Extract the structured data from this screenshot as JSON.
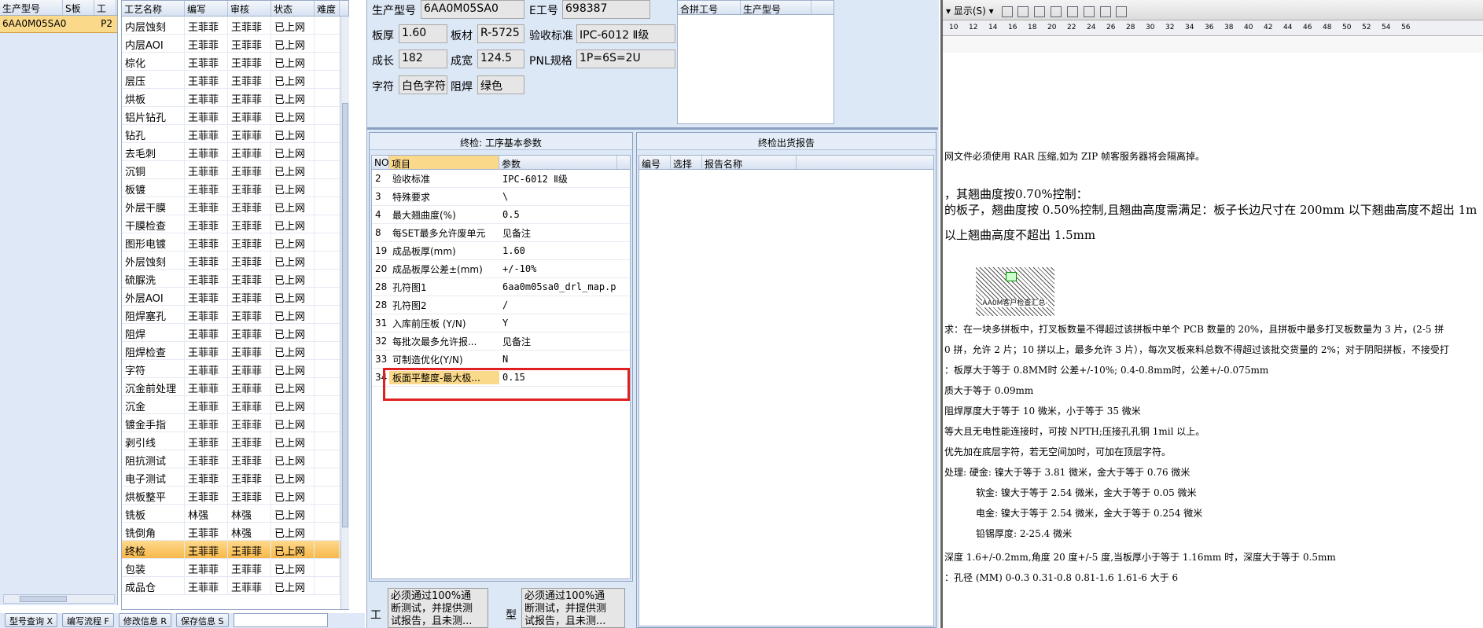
{
  "left_grid": {
    "headers": [
      "生产型号",
      "S板",
      "工"
    ],
    "selected_row": {
      "model": "6AA0M05SA0",
      "s": "P2"
    }
  },
  "process_grid": {
    "headers": [
      "工艺名称",
      "编写",
      "审核",
      "状态",
      "难度"
    ],
    "rows": [
      [
        "内层蚀刻",
        "王菲菲",
        "王菲菲",
        "已上网"
      ],
      [
        "内层AOI",
        "王菲菲",
        "王菲菲",
        "已上网"
      ],
      [
        "棕化",
        "王菲菲",
        "王菲菲",
        "已上网"
      ],
      [
        "层压",
        "王菲菲",
        "王菲菲",
        "已上网"
      ],
      [
        "烘板",
        "王菲菲",
        "王菲菲",
        "已上网"
      ],
      [
        "铝片钻孔",
        "王菲菲",
        "王菲菲",
        "已上网"
      ],
      [
        "钻孔",
        "王菲菲",
        "王菲菲",
        "已上网"
      ],
      [
        "去毛刺",
        "王菲菲",
        "王菲菲",
        "已上网"
      ],
      [
        "沉铜",
        "王菲菲",
        "王菲菲",
        "已上网"
      ],
      [
        "板镀",
        "王菲菲",
        "王菲菲",
        "已上网"
      ],
      [
        "外层干膜",
        "王菲菲",
        "王菲菲",
        "已上网"
      ],
      [
        "干膜检查",
        "王菲菲",
        "王菲菲",
        "已上网"
      ],
      [
        "图形电镀",
        "王菲菲",
        "王菲菲",
        "已上网"
      ],
      [
        "外层蚀刻",
        "王菲菲",
        "王菲菲",
        "已上网"
      ],
      [
        "硫脲洗",
        "王菲菲",
        "王菲菲",
        "已上网"
      ],
      [
        "外层AOI",
        "王菲菲",
        "王菲菲",
        "已上网"
      ],
      [
        "阻焊塞孔",
        "王菲菲",
        "王菲菲",
        "已上网"
      ],
      [
        "阻焊",
        "王菲菲",
        "王菲菲",
        "已上网"
      ],
      [
        "阻焊检查",
        "王菲菲",
        "王菲菲",
        "已上网"
      ],
      [
        "字符",
        "王菲菲",
        "王菲菲",
        "已上网"
      ],
      [
        "沉金前处理",
        "王菲菲",
        "王菲菲",
        "已上网"
      ],
      [
        "沉金",
        "王菲菲",
        "王菲菲",
        "已上网"
      ],
      [
        "镀金手指",
        "王菲菲",
        "王菲菲",
        "已上网"
      ],
      [
        "剥引线",
        "王菲菲",
        "王菲菲",
        "已上网"
      ],
      [
        "阻抗测试",
        "王菲菲",
        "王菲菲",
        "已上网"
      ],
      [
        "电子测试",
        "王菲菲",
        "王菲菲",
        "已上网"
      ],
      [
        "烘板整平",
        "王菲菲",
        "王菲菲",
        "已上网"
      ],
      [
        "铣板",
        "林强",
        "林强",
        "已上网"
      ],
      [
        "铣倒角",
        "王菲菲",
        "林强",
        "已上网"
      ],
      [
        "终检",
        "王菲菲",
        "王菲菲",
        "已上网"
      ],
      [
        "包装",
        "王菲菲",
        "王菲菲",
        "已上网"
      ],
      [
        "成品仓",
        "王菲菲",
        "王菲菲",
        "已上网"
      ]
    ],
    "active_index": 29
  },
  "bottom_buttons": [
    "型号查询 X",
    "编写流程 F",
    "修改信息 R",
    "保存信息 S"
  ],
  "info": {
    "model_label": "生产型号",
    "model_value": "6AA0M05SA0",
    "e_label": "E工号",
    "e_value": "698387",
    "thick_label": "板厚",
    "thick_value": "1.60",
    "mat_label": "板材",
    "mat_value": "R-5725",
    "std_label": "验收标准",
    "std_value": "IPC-6012 Ⅱ级",
    "len_label": "成长",
    "len_value": "182",
    "wid_label": "成宽",
    "wid_value": "124.5",
    "pnl_label": "PNL规格",
    "pnl_value": "1P=6S=2U",
    "char_label": "字符",
    "char_value": "白色字符",
    "mask_label": "阻焊",
    "mask_value": "绿色",
    "merge_headers": [
      "合拼工号",
      "生产型号"
    ]
  },
  "params_panel": {
    "title": "终检: 工序基本参数",
    "headers": [
      "NO",
      "项目",
      "参数"
    ],
    "rows": [
      [
        "2",
        "验收标准",
        "IPC-6012 Ⅱ级"
      ],
      [
        "3",
        "特殊要求",
        "\\"
      ],
      [
        "4",
        "最大翘曲度(%)",
        "0.5"
      ],
      [
        "8",
        "每SET最多允许废单元",
        "见备注"
      ],
      [
        "19",
        "成品板厚(mm)",
        "1.60"
      ],
      [
        "20",
        "成品板厚公差±(mm)",
        "+/-10%"
      ],
      [
        "28",
        "孔符图1",
        "6aa0m05sa0_drl_map.p"
      ],
      [
        "28",
        "孔符图2",
        "/"
      ],
      [
        "31",
        "入库前压板 (Y/N)",
        "Y"
      ],
      [
        "32",
        "每批次最多允许报...",
        "见备注"
      ],
      [
        "33",
        "可制造优化(Y/N)",
        "N"
      ],
      [
        "34",
        "板面平整度-最大极...",
        "0.15"
      ]
    ]
  },
  "report_panel": {
    "title": "终检出货报告",
    "headers": [
      "编号",
      "选择",
      "报告名称"
    ]
  },
  "bottom_text": {
    "a_label": "工",
    "a_text": [
      "必须通过100%通",
      "断测试，并提供测",
      "试报告，且未测..."
    ],
    "b_label": "型",
    "b_text": [
      "必须通过100%通",
      "断测试，并提供测",
      "试报告，且未测..."
    ]
  },
  "doc": {
    "toolbar_label": "显示(S)",
    "ruler": [
      "10",
      "12",
      "14",
      "16",
      "18",
      "20",
      "22",
      "24",
      "26",
      "28",
      "30",
      "32",
      "34",
      "36",
      "38",
      "40",
      "42",
      "44",
      "46",
      "48",
      "50",
      "52",
      "54",
      "56"
    ],
    "lines": [
      "网文件必须使用 RAR 压缩,如为 ZIP 帧客服务器将会隔离掉。",
      "，其翘曲度按0.70%控制：",
      "的板子，翘曲度按 0.50%控制,且翘曲高度需满足：板子长边尺寸在 200mm 以下翘曲高度不超出 1m",
      "以上翘曲高度不超出 1.5mm",
      "求：在一块多拼板中，打叉板数量不得超过该拼板中单个 PCB 数量的 20%，且拼板中最多打叉板数量为 3 片，(2-5 拼",
      "0 拼，允许 2 片；10 拼以上，最多允许 3 片），每次叉板来料总数不得超过该批交货量的 2%；对于阴阳拼板，不接受打",
      "：板厚大于等于 0.8MM时   公差+/-10%;                        0.4-0.8mm时，公差+/-0.075mm",
      "质大于等于 0.09mm",
      "阻焊厚度大于等于 10 微米，小于等于 35 微米",
      "等大且无电性能连接时，可按 NPTH;压接孔孔铜 1mil 以上。",
      "优先加在底层字符，若无空间加时，可加在顶层字符。",
      "处理: 硬金: 镍大于等于 3.81 微米，金大于等于 0.76 微米",
      "软金: 镍大于等于 2.54 微米，金大于等于 0.05 微米",
      "电金: 镍大于等于 2.54 微米，金大于等于 0.254 微米",
      "铅锡厚度: 2-25.4 微米",
      "深度 1.6+/-0.2mm,角度 20 度+/-5 度,当板厚小于等于 1.16mm 时，深度大于等于 0.5mm",
      "：孔径 (MM)             0-0.3              0.31-0.8        0.81-1.6            1.61-6           大于 6"
    ],
    "stamp_text": "AA0M客户检查汇总-"
  },
  "colors": {
    "highlight_box": "#e02020",
    "active_row": "#f7b84a",
    "panel_bg": "#dde8f6"
  }
}
